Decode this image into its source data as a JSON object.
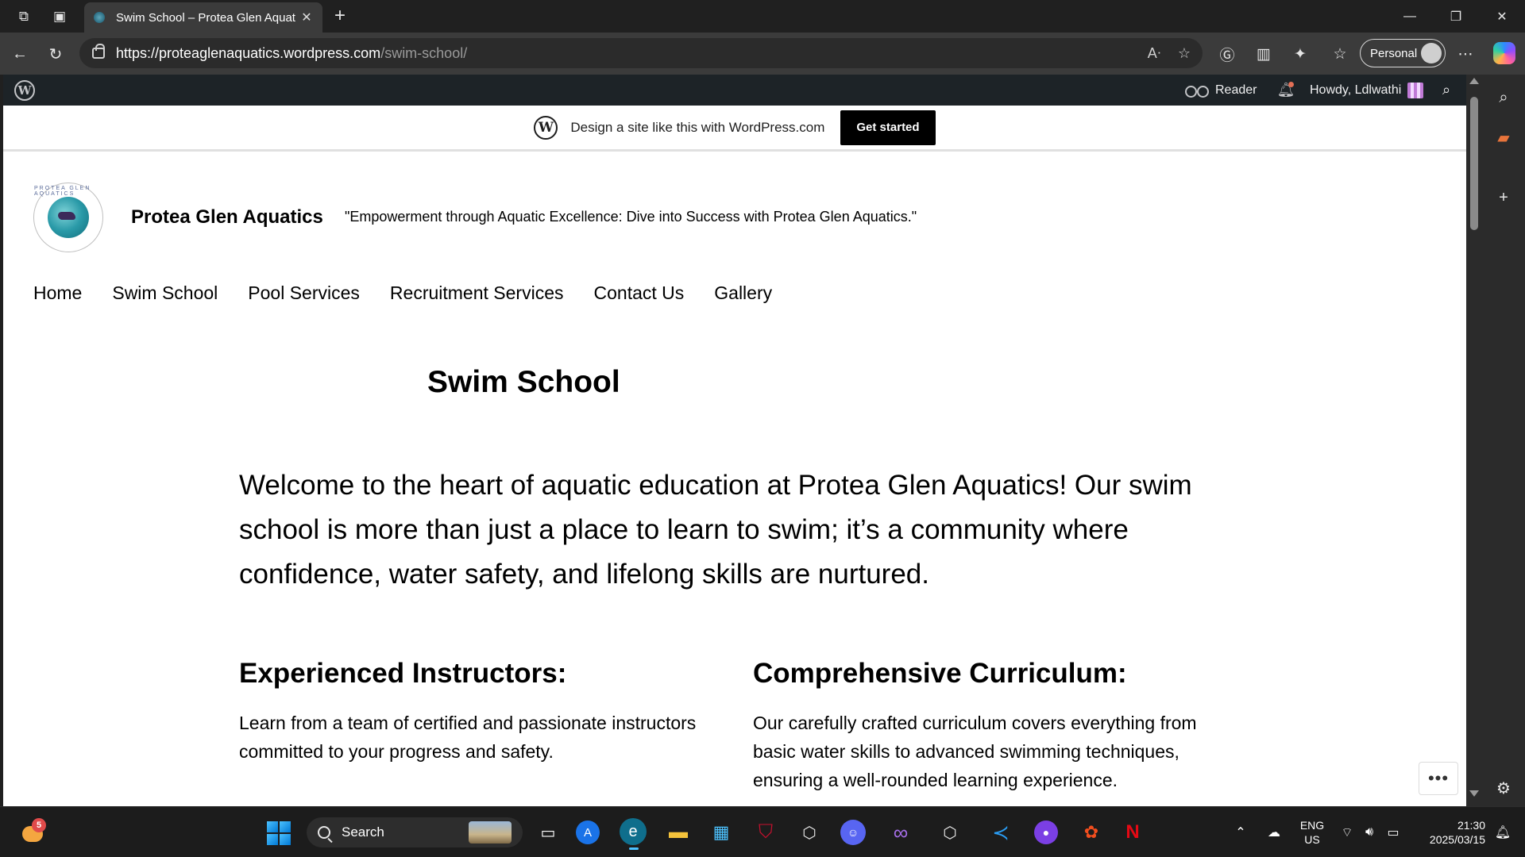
{
  "browser": {
    "tab_title": "Swim School – Protea Glen Aquat",
    "tab_close": "✕",
    "new_tab": "+",
    "url_host": "https://proteaglenaquatics.wordpress.com",
    "url_path": "/swim-school/",
    "profile_label": "Personal"
  },
  "wp_admin_bar": {
    "reader_label": "Reader",
    "howdy_label": "Howdy, Ldlwathi"
  },
  "promo": {
    "text": "Design a site like this with WordPress.com",
    "button_label": "Get started"
  },
  "site": {
    "logo_ring_text": "PROTEA GLEN AQUATICS",
    "title": "Protea Glen Aquatics",
    "tagline": "\"Empowerment through Aquatic Excellence: Dive into Success with Protea Glen Aquatics.\"",
    "nav": [
      "Home",
      "Swim School",
      "Pool Services",
      "Recruitment Services",
      "Contact Us",
      "Gallery"
    ]
  },
  "page": {
    "title": "Swim School",
    "intro": "Welcome to the heart of aquatic education at Protea Glen Aquatics! Our swim school is more than just a place to learn to swim; it’s a community where confidence, water safety, and lifelong skills are nurtured.",
    "sections": [
      {
        "heading": "Experienced Instructors:",
        "body": "Learn from a team of certified and passionate instructors committed to your progress and safety."
      },
      {
        "heading": "Comprehensive Curriculum:",
        "body": "Our carefully crafted curriculum covers everything from basic water skills to advanced swimming techniques, ensuring a well-rounded learning experience."
      }
    ],
    "more_button": "•••"
  },
  "taskbar": {
    "weather_badge": "5",
    "search_label": "Search",
    "lang_top": "ENG",
    "lang_bottom": "US",
    "time": "21:30",
    "date": "2025/03/15"
  },
  "colors": {
    "admin_bar": "#1d2327",
    "browser_chrome": "#3b3b3b",
    "taskbar": "#1c1c1c"
  }
}
